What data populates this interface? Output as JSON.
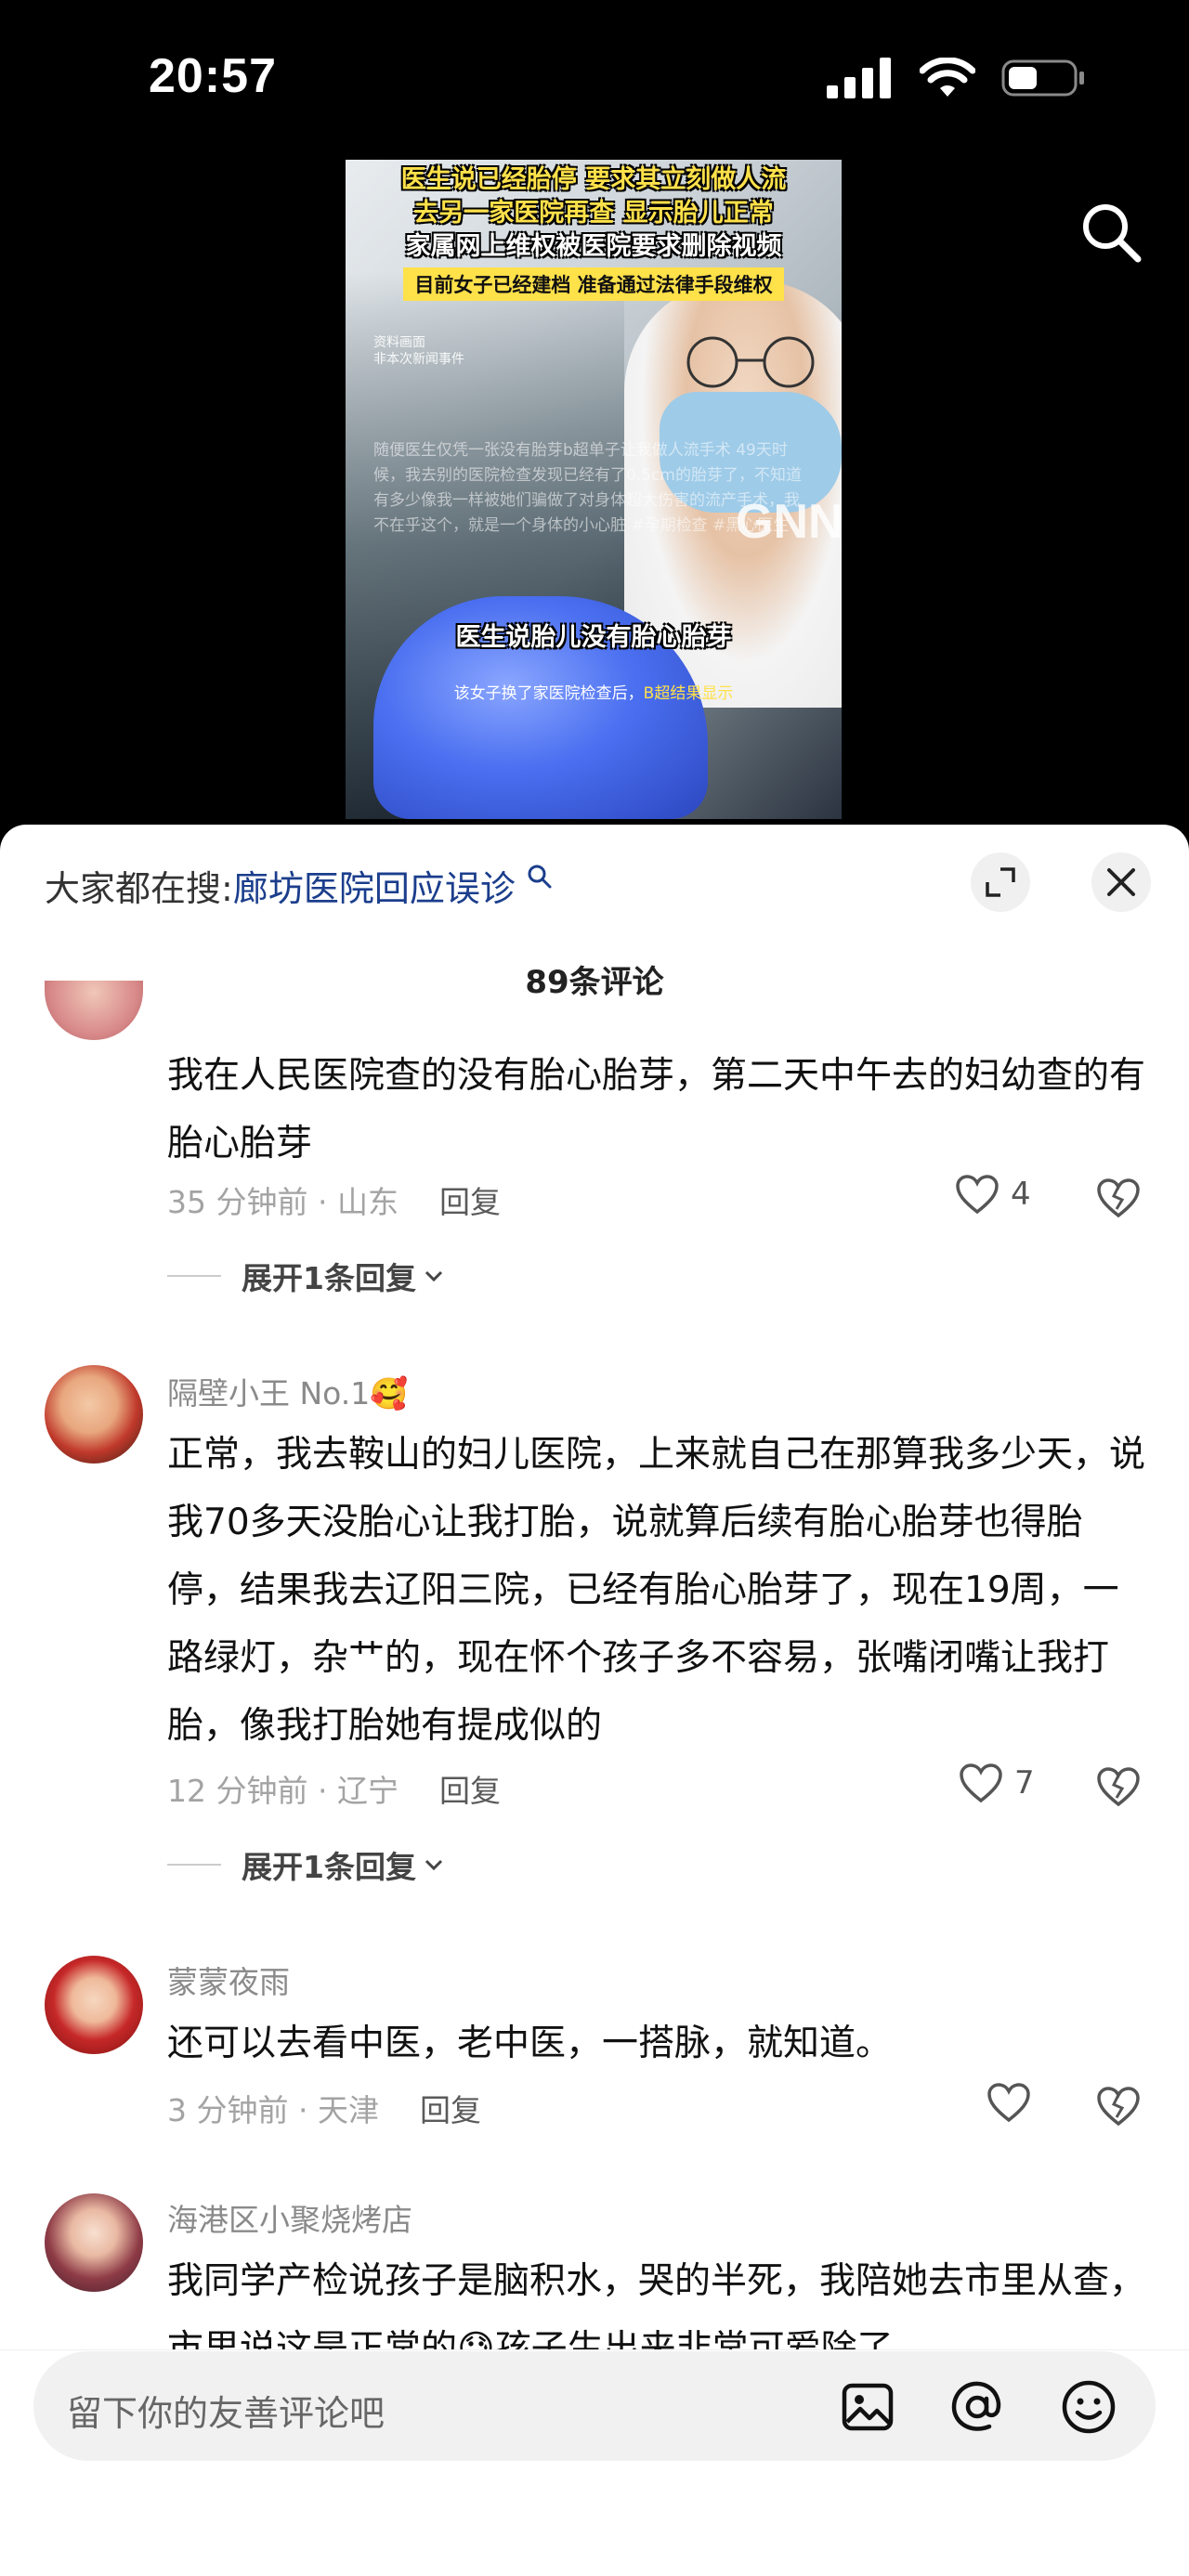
{
  "status_bar": {
    "time": "20:57"
  },
  "video": {
    "title_lines": [
      "医生说已经胎停 要求其立刻做人流",
      "去另一家医院再查 显示胎儿正常",
      "家属网上维权被医院要求删除视频"
    ],
    "banner": "目前女子已经建档 准备通过法律手段维权",
    "small_note_1": "资料画面",
    "small_note_2": "非本次新闻事件",
    "blurred_text": "随便医生仅凭一张没有胎芽b超单子让我做人流手术 49天时候，我去别的医院检查发现已经有了0.5cm的胎芽了，不知道有多少像我一样被她们骗做了对身体超大伤害的流产手术，我不在乎这个，就是一个身体的小心脏 #孕期检查 #黑心医生",
    "watermark": "GNN",
    "caption": "医生说胎儿没有胎心胎芽",
    "note_prefix": "该女子换了家医院检查后，",
    "note_highlight": "B超结果显示"
  },
  "panel": {
    "hot_search_prefix": "大家都在搜:",
    "hot_search_link": "廊坊医院回应误诊",
    "comment_count": "89条评论"
  },
  "comments": [
    {
      "user": "",
      "text": "我在人民医院查的没有胎心胎芽，第二天中午去的妇幼查的有胎心胎芽",
      "time_location": "35 分钟前 · 山东",
      "reply_label": "回复",
      "likes": "4",
      "expand_label": "展开1条回复"
    },
    {
      "user": "隔壁小王 No.1🥰",
      "text": "正常，我去鞍山的妇儿医院，上来就自己在那算我多少天，说我70多天没胎心让我打胎，说就算后续有胎心胎芽也得胎停，结果我去辽阳三院，已经有胎心胎芽了，现在19周，一路绿灯，杂艹的，现在怀个孩子多不容易，张嘴闭嘴让我打胎，像我打胎她有提成似的",
      "time_location": "12 分钟前 · 辽宁",
      "reply_label": "回复",
      "likes": "7",
      "expand_label": "展开1条回复"
    },
    {
      "user": "蒙蒙夜雨",
      "text": "还可以去看中医，老中医，一搭脉，就知道。",
      "time_location": "3 分钟前 · 天津",
      "reply_label": "回复",
      "likes": ""
    },
    {
      "user": "海港区小聚烧烤店",
      "text": "我同学产检说孩子是脑积水，哭的半死，我陪她去市里从查，市里说这是正常的😓孩子生出来非常可爱除了"
    }
  ],
  "input": {
    "placeholder": "留下你的友善评论吧"
  },
  "colors": {
    "link": "#1b3e8c",
    "banner": "#ffe14a",
    "glove": "#4a6ff0"
  }
}
